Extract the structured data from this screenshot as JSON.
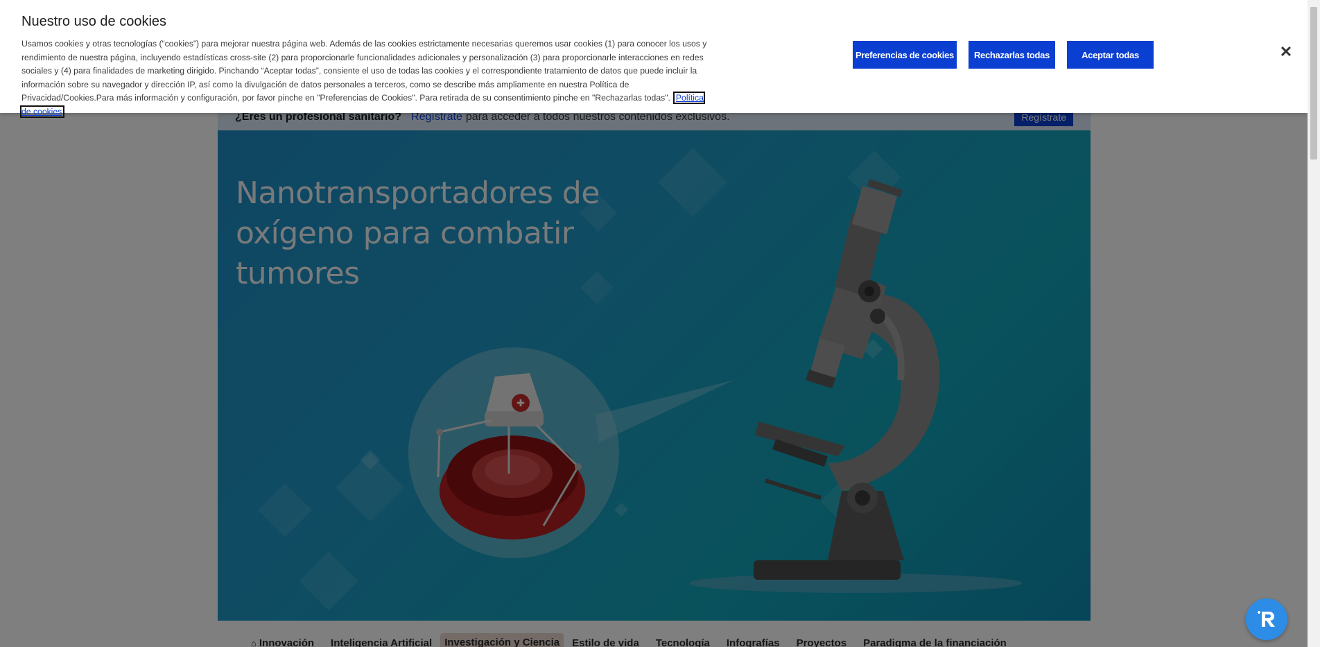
{
  "cookie_banner": {
    "title": "Nuestro uso de cookies",
    "text": "Usamos cookies y otras tecnologías (“cookies”) para mejorar nuestra página web. Además de las cookies estrictamente necesarias queremos usar cookies (1) para conocer los usos y rendimiento de nuestra página, incluyendo estadísticas cross-site (2) para proporcionarle funcionalidades adicionales y personalización (3) para proporcionarle interacciones en redes sociales y (4) para finalidades de marketing dirigido. Pinchando “Aceptar todas”, consiente el uso de todas las cookies y el correspondiente tratamiento de datos que puede incluir la información sobre su navegador y dirección IP, así como la divulgación de datos personales a terceros, como se describe más ampliamente en nuestra Política de Privacidad/Cookies.Para más información y configuración, por favor pinche en \"Preferencias de Cookies\". Para retirada de su consentimiento pinche en \"Rechazarlas todas\".",
    "policy_link": "Política de cookies",
    "preferences_button": "Preferencias de cookies",
    "reject_button": "Rechazarlas todas",
    "accept_button": "Aceptar todas",
    "close_glyph": "✕"
  },
  "pro_bar": {
    "title": "¿Eres un profesional sanitario?",
    "link": "Regístrate",
    "text": "para acceder a todos nuestros contenidos exclusivos.",
    "button": "Regístrate"
  },
  "hero": {
    "title": "Nanotransportadores de oxígeno para combatir tumores"
  },
  "nav": {
    "items": [
      {
        "label": "Innovación"
      },
      {
        "label": "Inteligencia Artificial"
      },
      {
        "label": "Investigación y Ciencia"
      },
      {
        "label": "Estilo de vida"
      },
      {
        "label": "Tecnología"
      },
      {
        "label": "Infografías"
      },
      {
        "label": "Proyectos"
      },
      {
        "label": "Paradigma de la financiación"
      }
    ]
  },
  "icons": {
    "home": "home-icon",
    "close": "close-icon",
    "chat": "chat-assistant-icon"
  }
}
